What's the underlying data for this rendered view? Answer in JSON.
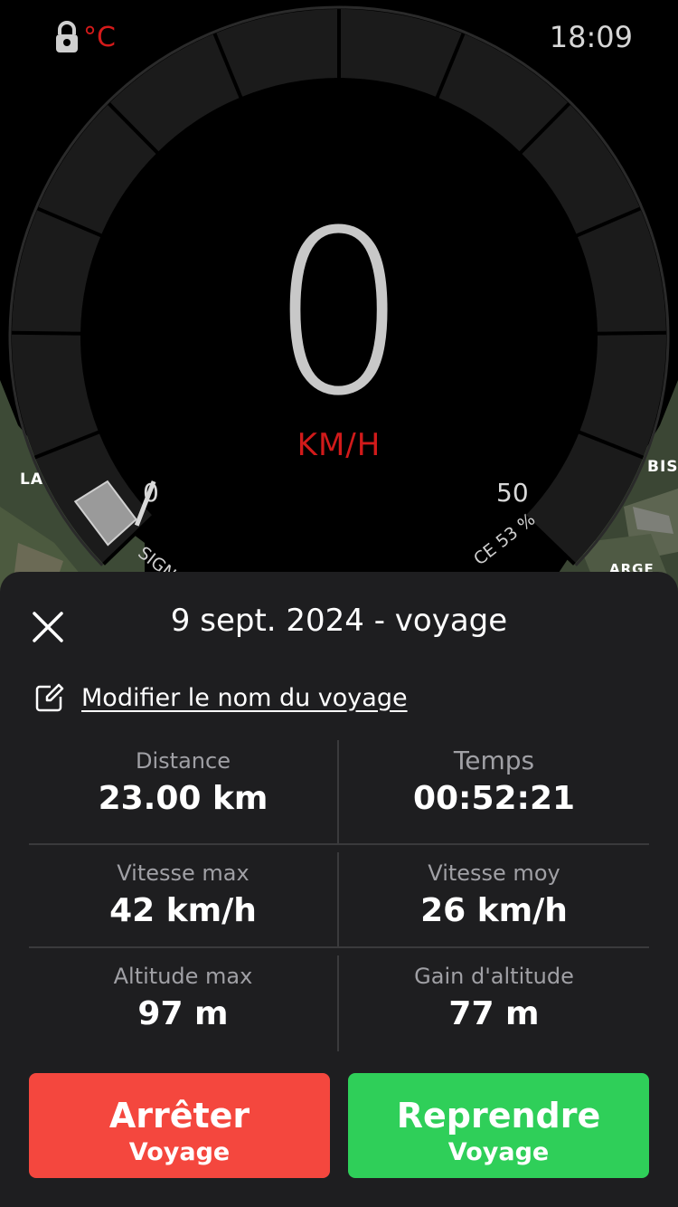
{
  "status": {
    "temp_unit": "°C",
    "time": "18:09",
    "lock_icon": "lock-icon"
  },
  "speedometer": {
    "speed": "0",
    "unit": "KM/H",
    "tick_min": "0",
    "tick_max": "50",
    "left_arc_label": "SIGNA",
    "right_arc_label": "CE 53 %"
  },
  "map": {
    "label_left": "LA",
    "label_right": "BISC",
    "label_bottom_right": "ARGE"
  },
  "trip": {
    "title": "9 sept. 2024 - voyage",
    "rename_link": "Modifier le nom du voyage",
    "close_icon": "close-icon",
    "edit_icon": "edit-icon"
  },
  "stats": {
    "distance_label": "Distance",
    "distance_value": "23.00 km",
    "time_label": "Temps",
    "time_value": "00:52:21",
    "max_speed_label": "Vitesse max",
    "max_speed_value": "42 km/h",
    "avg_speed_label": "Vitesse moy",
    "avg_speed_value": "26 km/h",
    "max_alt_label": "Altitude max",
    "max_alt_value": "97 m",
    "alt_gain_label": "Gain d'altitude",
    "alt_gain_value": "77 m"
  },
  "actions": {
    "stop_main": "Arrêter",
    "stop_sub": "Voyage",
    "resume_main": "Reprendre",
    "resume_sub": "Voyage"
  },
  "colors": {
    "accent_red": "#d11a1a",
    "stop_button": "#f4473e",
    "resume_button": "#2fcf59",
    "sheet_bg": "#1e1e20"
  }
}
